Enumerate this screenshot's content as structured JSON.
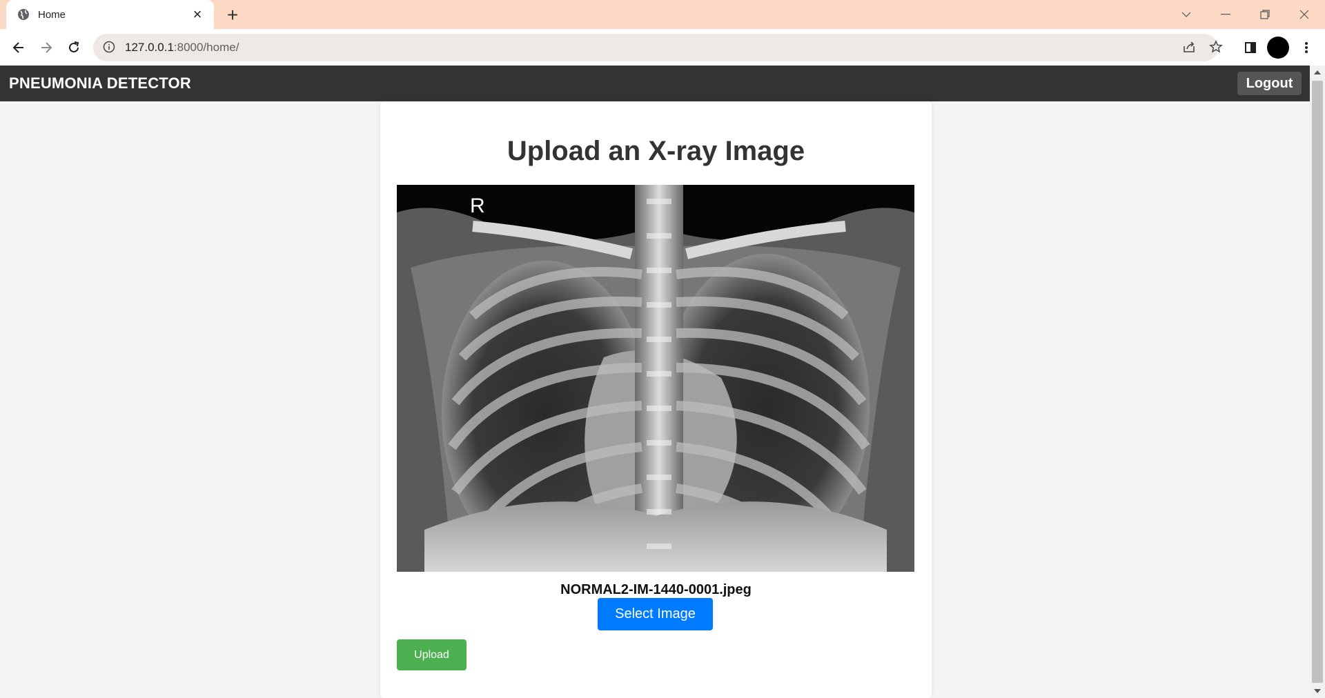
{
  "browser": {
    "tab": {
      "title": "Home",
      "icon": "globe-icon"
    },
    "url": {
      "host": "127.0.0.1",
      "path": ":8000/home/"
    }
  },
  "navbar": {
    "brand": "PNEUMONIA DETECTOR",
    "logout_label": "Logout"
  },
  "main": {
    "heading": "Upload an X-ray Image",
    "image": {
      "orientation_marker": "R"
    },
    "filename": "NORMAL2-IM-1440-0001.jpeg",
    "select_label": "Select Image",
    "upload_label": "Upload"
  },
  "colors": {
    "navbar_bg": "#333333",
    "select_button": "#007bff",
    "upload_button": "#4caf50",
    "tab_strip": "#fbd9c4"
  }
}
